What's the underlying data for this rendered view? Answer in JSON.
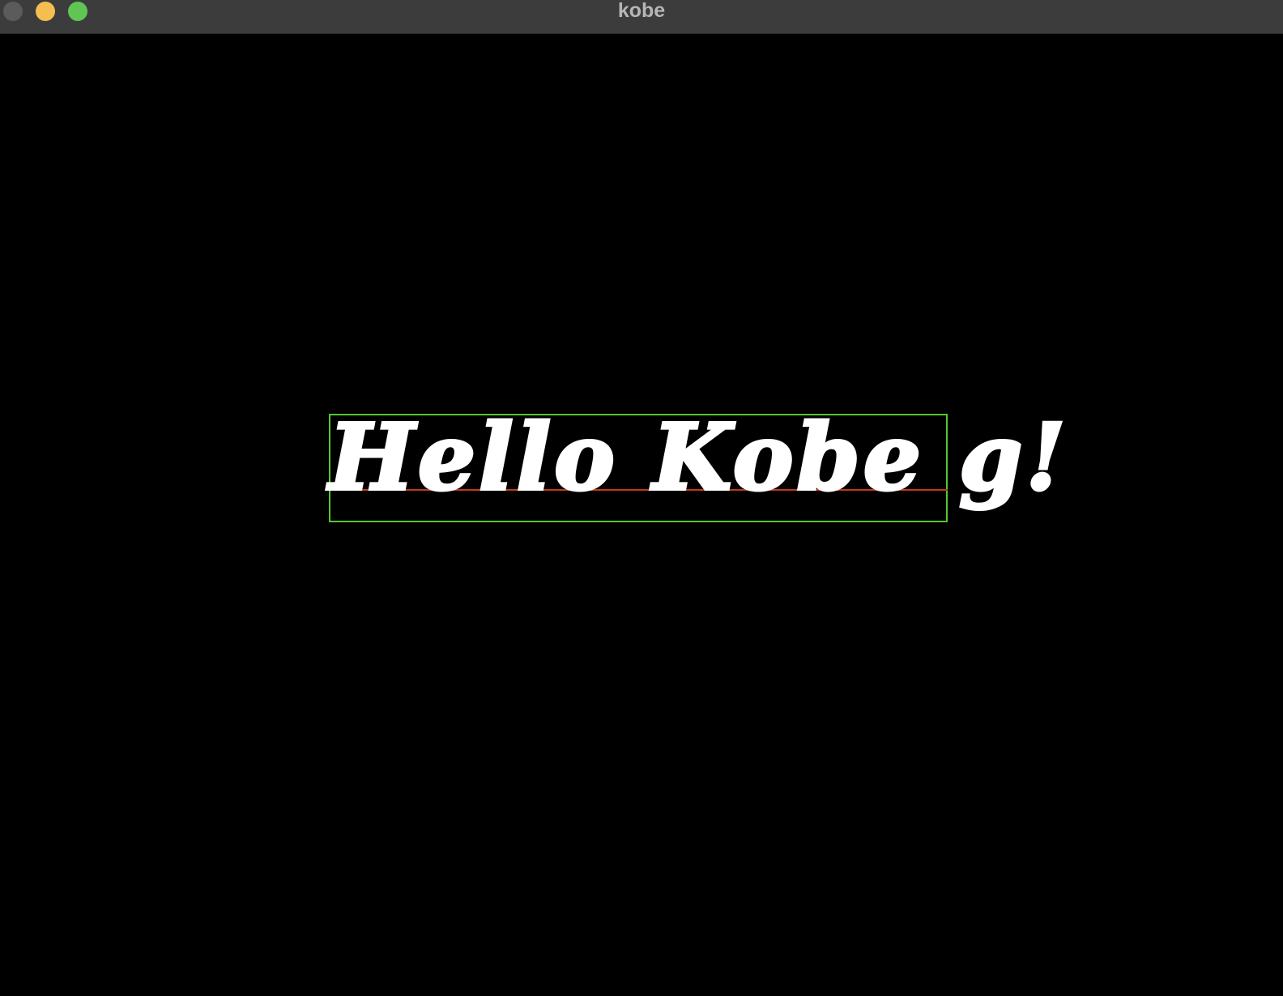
{
  "window": {
    "title": "kobe"
  },
  "canvas": {
    "text": "Hello Kobe g!",
    "colors": {
      "background": "#000000",
      "text": "#ffffff",
      "bounding_box": "#55c72e",
      "baseline": "#c4391b"
    }
  },
  "controls": {
    "close_color": "#5b5b5b",
    "minimize_color": "#f4bf4f",
    "maximize_color": "#61c554"
  }
}
